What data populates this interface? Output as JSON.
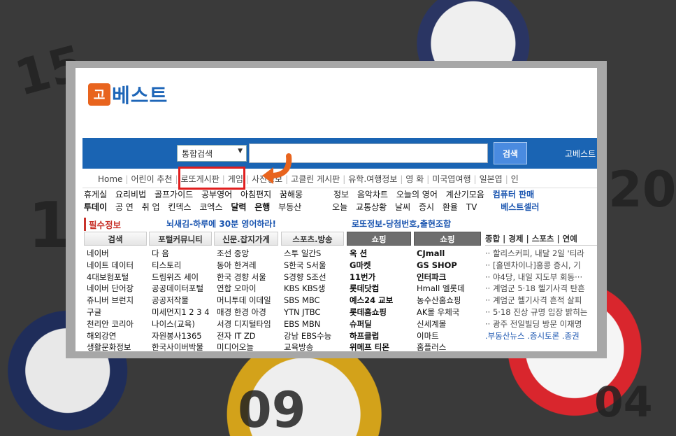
{
  "background": {
    "numbers": [
      "15",
      "1",
      "20",
      "09",
      "04"
    ]
  },
  "logo": {
    "mark": "고",
    "text": "베스트"
  },
  "search": {
    "select_value": "통합검색",
    "placeholder": "",
    "button_label": "검색",
    "brand": "고베스트"
  },
  "nav": {
    "items": [
      "Home",
      "어린이 추천",
      "로또게시판",
      "게임",
      "사진정보",
      "고클린 게시판",
      "유학.여행정보",
      "영 화",
      "미국엽여행",
      "일본엽",
      "인"
    ]
  },
  "links": {
    "row1": [
      "휴게실",
      "요리비법",
      "골프가이드",
      "공부영어",
      "아침편지",
      "꿈해몽",
      "정보",
      "음악차트",
      "오늘의 영어",
      "계산기모음"
    ],
    "row1_blue": "컴퓨터 판매",
    "row2": [
      "투데이",
      "공 연",
      "취 업",
      "킨덱스",
      "코엑스",
      "달력",
      "은행",
      "부동산",
      "오늘",
      "교통상황",
      "날씨",
      "증시",
      "환율",
      "TV"
    ],
    "row2_blue": "베스트셀러"
  },
  "must_info": {
    "label": "필수정보",
    "headline1": "뇌새김-하루에 30분 영어하라!",
    "headline2": "로또정보-당첨번호,출현조합"
  },
  "columns": [
    {
      "header": "검색",
      "items": [
        "네이버",
        "네이트 데이터",
        "4대보험포털",
        "네이버 단어장",
        "쥬니버 브런치",
        "구글",
        "천리안 코리아",
        "해외강연",
        "생활문화정보"
      ]
    },
    {
      "header": "포털커뮤니티",
      "items": [
        "다 음",
        "티스토리",
        "드림위즈 세이",
        "공공데이터포털",
        "공공저작물",
        "미세먼지1 2 3 4",
        "나이스(교육)",
        "자원봉사1365",
        "한국사이버박물"
      ]
    },
    {
      "header": "신문.잡지가게",
      "items": [
        "조선 중앙",
        "동아 한겨레",
        "한국 경향 서울",
        "연합 오마이",
        "머니투데 이데일",
        "매경 한경 아경",
        "서경 디지털타임",
        "전자 IT ZD",
        "미디어오늘"
      ]
    },
    {
      "header": "스포츠.방송",
      "items": [
        "스투 일간S",
        "S한국 S서울",
        "S경향 S조선",
        "KBS KBS생",
        "SBS MBC",
        "YTN JTBC",
        "EBS MBN",
        "강남 EBS수능",
        "교육방송"
      ]
    },
    {
      "header": "쇼핑",
      "items": [
        "옥 션",
        "G마켓",
        "11번가",
        "롯데닷컴",
        "예스24 교보",
        "롯데홈쇼핑",
        "슈퍼딜",
        "하프클럽",
        "위메프 티몬"
      ]
    },
    {
      "header": "쇼핑",
      "items": [
        "CJmall",
        "GS SHOP",
        "인터파크",
        "Hmall 엘롯데",
        "농수산홈쇼핑",
        "AK몰 우체국",
        "신세계몰",
        "이마트",
        "홈플러스"
      ]
    }
  ],
  "news": {
    "tabs": "종합 | 경제 | 스포츠 | 연예",
    "items": [
      "할리스커피, 내달 2일 '티라",
      "[홀덴차이나]홍콩 증시, 기",
      "야4당, 내일 지도부 회동···",
      "계엄군 5·18 헬기사격 탄흔",
      "계엄군 헬기사격 흔적 살피",
      "5·18 진상 규명 입장 밝히는",
      "광주 전일빌딩 방문 이재명"
    ],
    "footer": ".부동산뉴스 .증시토론 .종권"
  }
}
